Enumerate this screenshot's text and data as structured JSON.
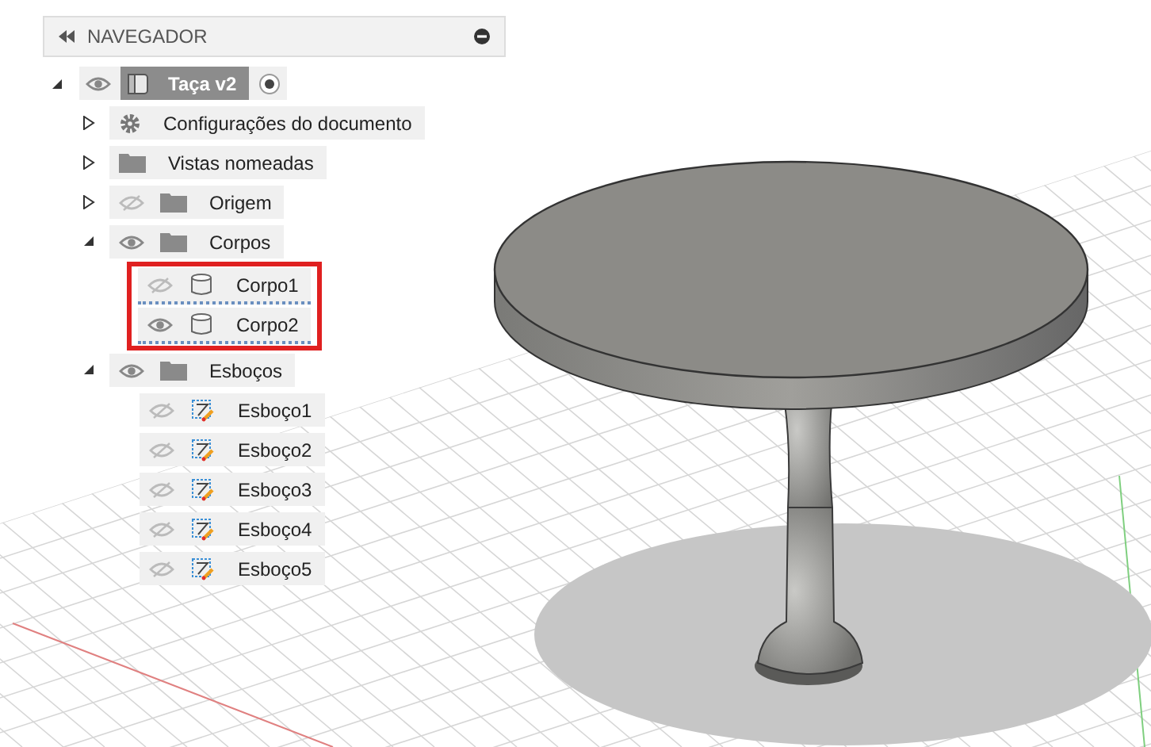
{
  "navigator": {
    "title": "NAVEGADOR"
  },
  "tree": [
    {
      "kind": "component",
      "label": "Taça v2",
      "expanded": true,
      "visible": true,
      "active": true,
      "children": [
        {
          "kind": "settings",
          "label": "Configurações do documento",
          "expanded": false
        },
        {
          "kind": "folder",
          "label": "Vistas nomeadas",
          "expanded": false
        },
        {
          "kind": "folder",
          "label": "Origem",
          "expanded": false,
          "visible": false
        },
        {
          "kind": "folder",
          "label": "Corpos",
          "expanded": true,
          "visible": true,
          "children_highlighted": true,
          "children": [
            {
              "kind": "body",
              "label": "Corpo1",
              "visible": false
            },
            {
              "kind": "body",
              "label": "Corpo2",
              "visible": true
            }
          ]
        },
        {
          "kind": "folder",
          "label": "Esboços",
          "expanded": true,
          "visible": true,
          "children_highlighted": false,
          "children": [
            {
              "kind": "sketch",
              "label": "Esboço1",
              "visible": false
            },
            {
              "kind": "sketch",
              "label": "Esboço2",
              "visible": false
            },
            {
              "kind": "sketch",
              "label": "Esboço3",
              "visible": false
            },
            {
              "kind": "sketch",
              "label": "Esboço4",
              "visible": false
            },
            {
              "kind": "sketch",
              "label": "Esboço5",
              "visible": false
            }
          ]
        }
      ]
    }
  ]
}
